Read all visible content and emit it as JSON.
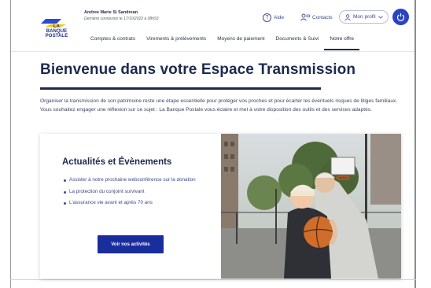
{
  "header": {
    "logo_alt_lines": [
      "LA",
      "BANQUE",
      "POSTALE"
    ],
    "user_name": "Andree Marie Si Sandrean",
    "last_login": "Dernière connexion le 17/10/2022 à 08h53",
    "aide_label": "Aide",
    "contacts_label": "Contacts",
    "profil_label": "Mon profil",
    "icons": {
      "aide": "question-circle-icon",
      "contacts": "contacts-icon",
      "profil": "user-icon",
      "power": "power-icon"
    }
  },
  "nav": {
    "items": [
      {
        "label": "Comptes & contrats"
      },
      {
        "label": "Virements & prélèvements"
      },
      {
        "label": "Moyens de paiement"
      },
      {
        "label": "Documents & Suivi"
      },
      {
        "label": "Notre offre",
        "active": true
      }
    ]
  },
  "main": {
    "title": "Bienvenue dans votre Espace Transmission",
    "intro": "Organiser la transmission de son patrimoine reste une étape essentielle pour protéger vos proches et pour écarter les éventuels risques de litiges familiaux. Vous souhaitez engager une réflexion sur ce sujet : La Banque Postale vous éclaire et met à votre disposition des outils et des services adaptés."
  },
  "card": {
    "title": "Actualités et Évènements",
    "items": [
      "Assister à notre prochaine webconférence sur la donation",
      "La protection du conjoint survivant",
      "L'assurance vie avant et après 70 ans"
    ],
    "button_label": "Voir nos activités"
  },
  "colors": {
    "brand_navy": "#1d2a4d",
    "brand_blue": "#1a2d9c",
    "power_blue": "#2a44c4",
    "link_blue": "#3b4a8a",
    "logo_yellow": "#f5c400"
  }
}
